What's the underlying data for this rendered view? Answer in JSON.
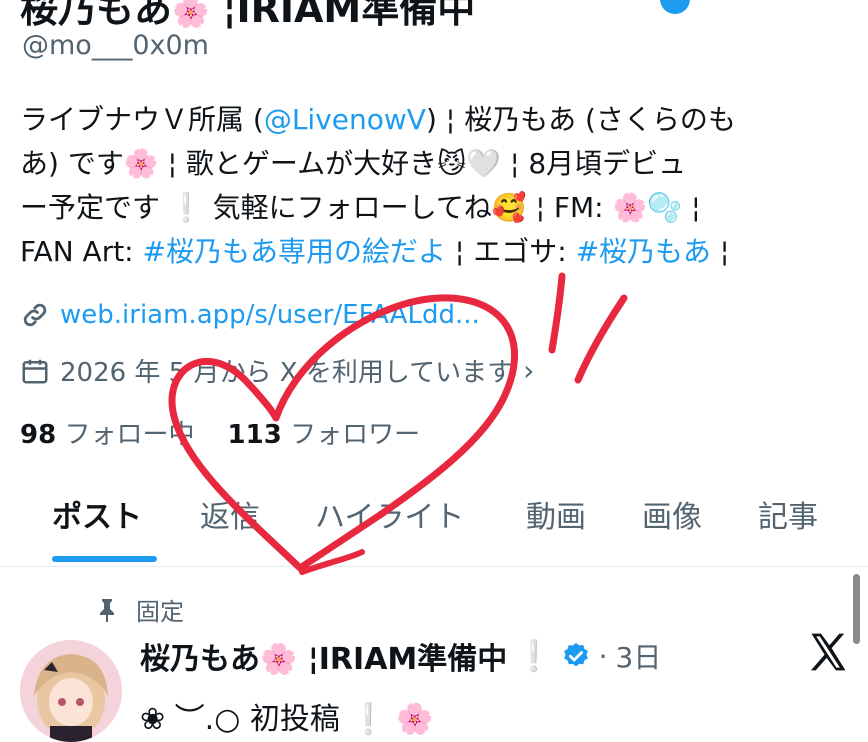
{
  "profile": {
    "display_name": "桜乃もあ",
    "name_emoji": "🌸",
    "name_suffix": "¦IRIAM準備中",
    "handle": "@mo___0x0m",
    "bio_lines": [
      [
        "ライブナウＶ所属 (",
        "@LivenowV",
        ") ¦ 桜乃もあ (さくらのも"
      ],
      [
        "あ) です🌸 ¦ 歌とゲームが大好き😼🤍 ¦ 8月頃デビュ"
      ],
      [
        "ー予定です ❕ 気軽にフォローしてね🥰 ¦ FM: 🌸🫧 ¦"
      ],
      [
        "FAN Art: ",
        "#桜乃もあ専用の絵だよ",
        " ¦ エゴサ: ",
        "#桜乃もあ",
        " ¦"
      ]
    ],
    "website": "web.iriam.app/s/user/EFAALdd...",
    "joined": "2026 年 5 月から X を利用しています",
    "following_count": "98",
    "following_label": "フォロー中",
    "followers_count": "113",
    "followers_label": "フォロワー"
  },
  "tabs": [
    "ポスト",
    "返信",
    "ハイライト",
    "動画",
    "画像",
    "記事"
  ],
  "active_tab": "ポスト",
  "pinned_post": {
    "pin_label": "固定",
    "author": "桜乃もあ",
    "author_emoji": "🌸",
    "author_suffix": "¦IRIAM準備中",
    "exclaim": "❕",
    "time": "3日",
    "text": "❀ ︶.○ 初投稿 ❕ 🌸"
  },
  "colors": {
    "accent": "#1d9bf0",
    "text": "#0f1419",
    "secondary": "#536471",
    "annotation": "#e8283f"
  },
  "icons": [
    "link-icon",
    "calendar-icon",
    "chevron-right-icon",
    "pin-icon",
    "verified-badge-icon",
    "x-logo-icon"
  ]
}
